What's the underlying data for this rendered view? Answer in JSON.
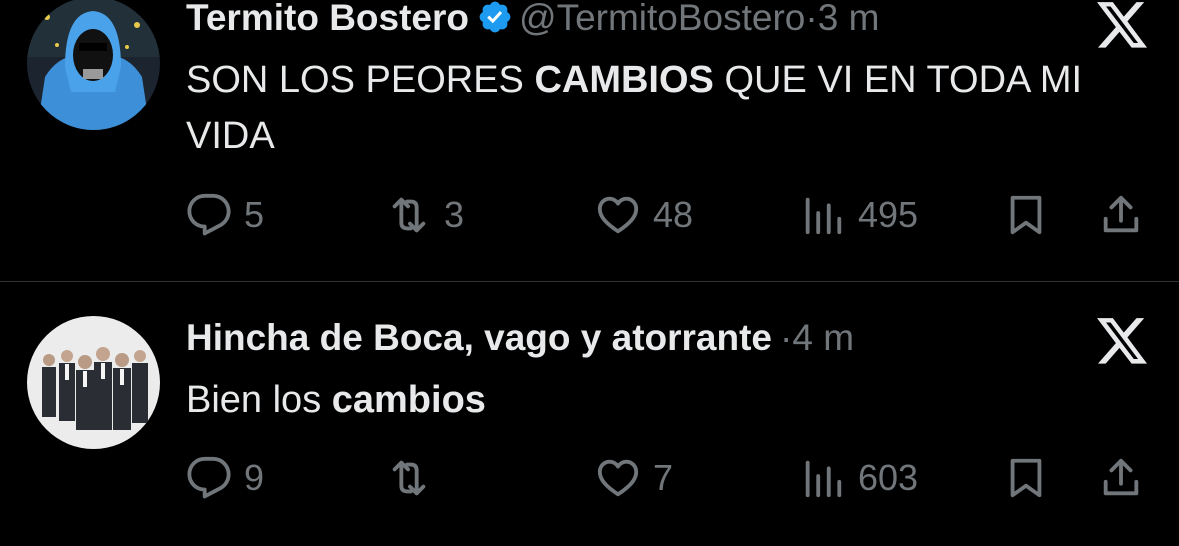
{
  "tweets": [
    {
      "name": "Termito Bostero",
      "handle": "@TermitoBostero",
      "dot": "·",
      "time": "3 m",
      "verified": true,
      "text_parts": [
        "SON LOS PEORES ",
        "CAMBIOS",
        " QUE VI EN TODA MI VIDA"
      ],
      "replies": "5",
      "reposts": "3",
      "likes": "48",
      "views": "495"
    },
    {
      "name": "Hincha de Boca, vago y atorrante",
      "dot": "·",
      "time": "4 m",
      "verified": false,
      "text_parts": [
        "Bien los ",
        "cambios"
      ],
      "replies": "9",
      "reposts": "",
      "likes": "7",
      "views": "603"
    }
  ],
  "colors": {
    "background": "#000000",
    "primary_text": "#e7e9ea",
    "secondary_text": "#71767b",
    "verified_badge": "#1d9bf0",
    "divider": "#2f3336"
  },
  "icons": [
    "verified-badge-icon",
    "x-logo-icon",
    "reply-icon",
    "repost-icon",
    "like-icon",
    "views-icon",
    "bookmark-icon",
    "share-icon"
  ]
}
